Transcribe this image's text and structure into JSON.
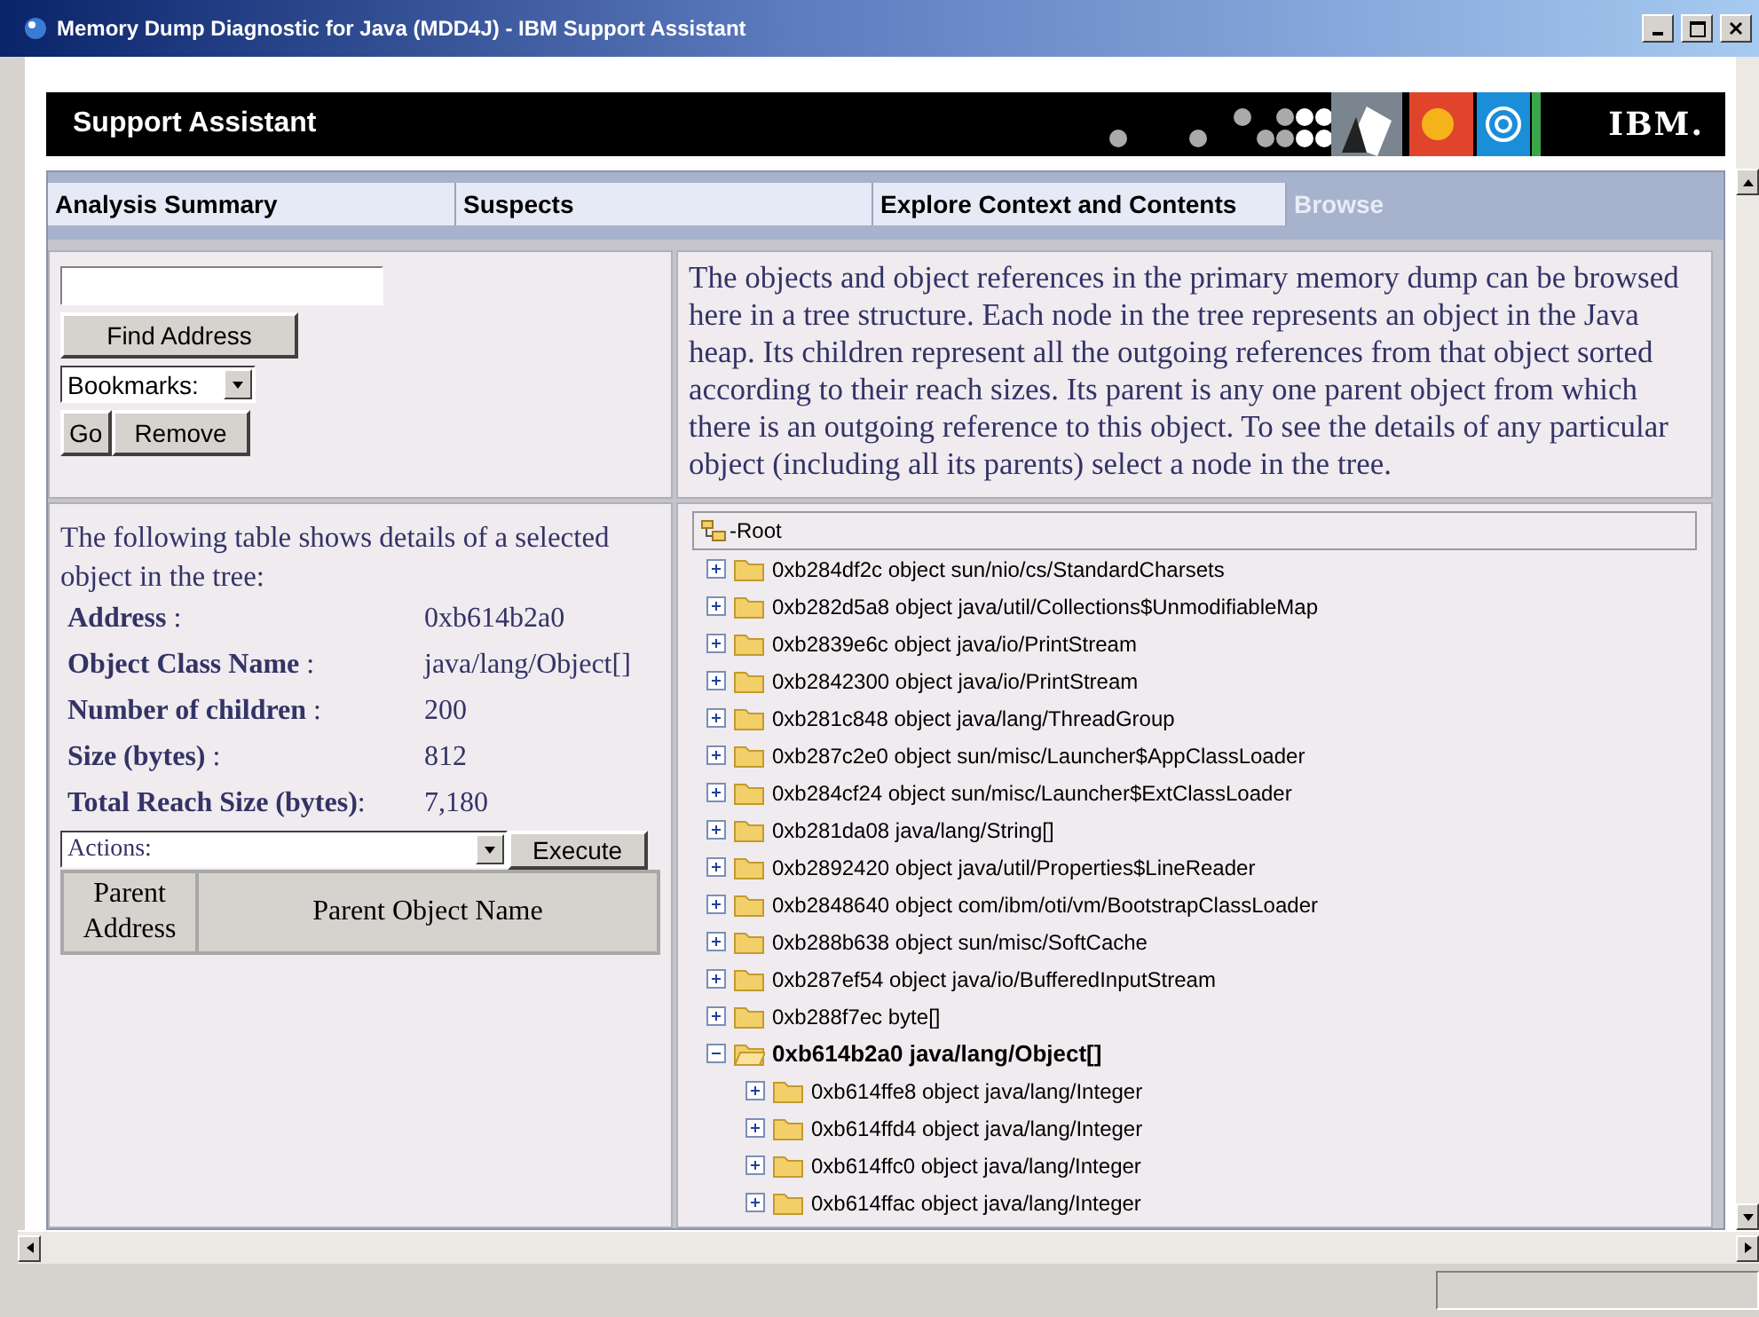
{
  "window": {
    "title": "Memory Dump Diagnostic for Java (MDD4J) - IBM Support Assistant"
  },
  "header": {
    "title": "Support Assistant",
    "logo": "IBM."
  },
  "tabs": [
    {
      "label": "Analysis Summary",
      "selected": false
    },
    {
      "label": "Suspects",
      "selected": false
    },
    {
      "label": "Explore Context and Contents",
      "selected": false
    },
    {
      "label": "Browse",
      "selected": true
    }
  ],
  "find": {
    "find_button": "Find Address",
    "bookmarks": "Bookmarks:",
    "go_button": "Go",
    "remove_button": "Remove"
  },
  "description": "The objects and object references in the primary memory dump can be browsed here in a tree structure. Each node in the tree represents an object in the Java heap. Its children represent all the outgoing references from that object sorted according to their reach sizes. Its parent is any one parent object from which there is an outgoing reference to this object. To see the details of any particular object (including all its parents) select a node in the tree.",
  "details": {
    "intro": "The following table shows details of a selected object in the tree:",
    "fields": [
      {
        "label": "Address",
        "sep": " :",
        "value": "0xb614b2a0"
      },
      {
        "label": "Object Class Name",
        "sep": " :",
        "value": "java/lang/Object[]"
      },
      {
        "label": "Number of children",
        "sep": " :",
        "value": "200"
      },
      {
        "label": "Size (bytes)",
        "sep": " :",
        "value": "812"
      },
      {
        "label": "Total Reach Size (bytes)",
        "sep": ":",
        "value": "7,180"
      }
    ],
    "actions": "Actions:",
    "execute_button": "Execute",
    "columns": [
      "Parent Address",
      "Parent Object Name"
    ]
  },
  "tree": {
    "root": "-Root",
    "children": [
      {
        "label": "0xb284df2c object sun/nio/cs/StandardCharsets",
        "expanded": false,
        "selected": false
      },
      {
        "label": "0xb282d5a8 object java/util/Collections$UnmodifiableMap",
        "expanded": false,
        "selected": false
      },
      {
        "label": "0xb2839e6c object java/io/PrintStream",
        "expanded": false,
        "selected": false
      },
      {
        "label": "0xb2842300 object java/io/PrintStream",
        "expanded": false,
        "selected": false
      },
      {
        "label": "0xb281c848 object java/lang/ThreadGroup",
        "expanded": false,
        "selected": false
      },
      {
        "label": "0xb287c2e0 object sun/misc/Launcher$AppClassLoader",
        "expanded": false,
        "selected": false
      },
      {
        "label": "0xb284cf24 object sun/misc/Launcher$ExtClassLoader",
        "expanded": false,
        "selected": false
      },
      {
        "label": "0xb281da08 java/lang/String[]",
        "expanded": false,
        "selected": false
      },
      {
        "label": "0xb2892420 object java/util/Properties$LineReader",
        "expanded": false,
        "selected": false
      },
      {
        "label": "0xb2848640 object com/ibm/oti/vm/BootstrapClassLoader",
        "expanded": false,
        "selected": false
      },
      {
        "label": "0xb288b638 object sun/misc/SoftCache",
        "expanded": false,
        "selected": false
      },
      {
        "label": "0xb287ef54 object java/io/BufferedInputStream",
        "expanded": false,
        "selected": false
      },
      {
        "label": "0xb288f7ec byte[]",
        "expanded": false,
        "selected": false
      },
      {
        "label": "0xb614b2a0 java/lang/Object[]",
        "expanded": true,
        "selected": true,
        "children": [
          {
            "label": "0xb614ffe8 object java/lang/Integer",
            "expanded": false,
            "selected": false
          },
          {
            "label": "0xb614ffd4 object java/lang/Integer",
            "expanded": false,
            "selected": false
          },
          {
            "label": "0xb614ffc0 object java/lang/Integer",
            "expanded": false,
            "selected": false
          },
          {
            "label": "0xb614ffac object java/lang/Integer",
            "expanded": false,
            "selected": false
          }
        ]
      }
    ]
  }
}
